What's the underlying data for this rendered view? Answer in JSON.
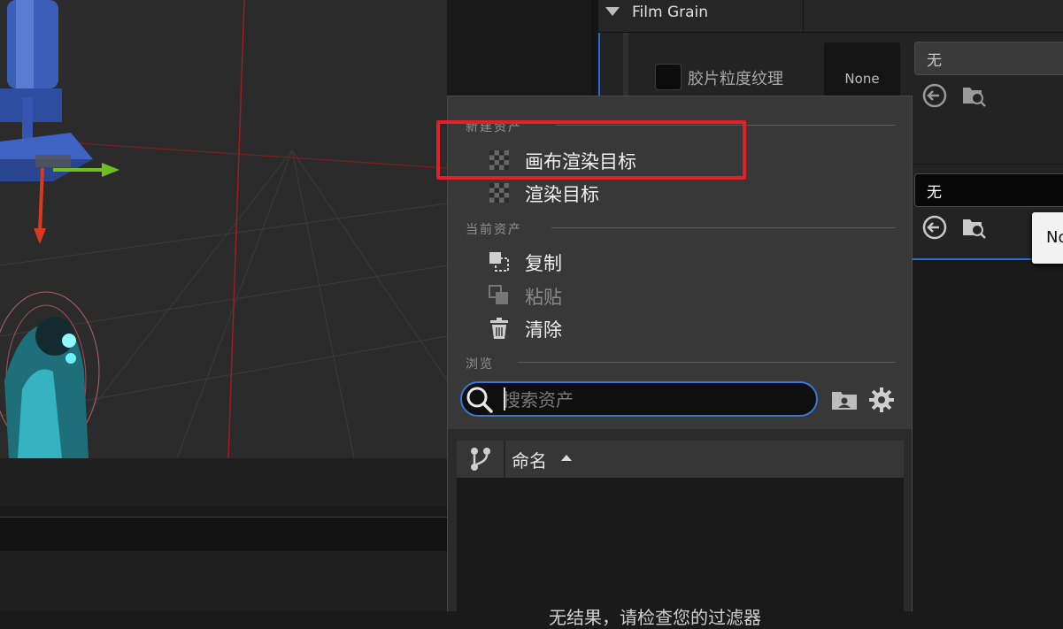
{
  "details": {
    "section_title": "Film Grain",
    "property_label": "胶片粒度纹理",
    "thumbnail_text": "None",
    "combo1_value": "无",
    "combo2_value": "无",
    "tooltip_text": "No"
  },
  "popup": {
    "section_new": "新建资产",
    "new_items": [
      "画布渲染目标",
      "渲染目标"
    ],
    "section_current": "当前资产",
    "current_items": [
      {
        "label": "复制",
        "enabled": true
      },
      {
        "label": "粘贴",
        "enabled": false
      },
      {
        "label": "清除",
        "enabled": true
      }
    ],
    "section_browse": "浏览",
    "search": {
      "placeholder": "搜索资产",
      "value": ""
    },
    "list_header": {
      "name_column": "命名"
    },
    "empty_message": "无结果，请检查您的过滤器"
  },
  "colors": {
    "highlight_box": "#e0202a",
    "search_focus": "#3a78d8",
    "accent": "#2f6bd1"
  },
  "icons": {
    "checker": "checker-texture-icon",
    "copy": "copy-icon",
    "paste": "paste-icon",
    "clear": "trash-icon",
    "search": "search-icon",
    "folder": "folder-icon",
    "settings": "gear-icon",
    "source_control": "branch-icon",
    "use_selected": "arrow-left-circle-icon",
    "browse": "folder-search-icon"
  }
}
